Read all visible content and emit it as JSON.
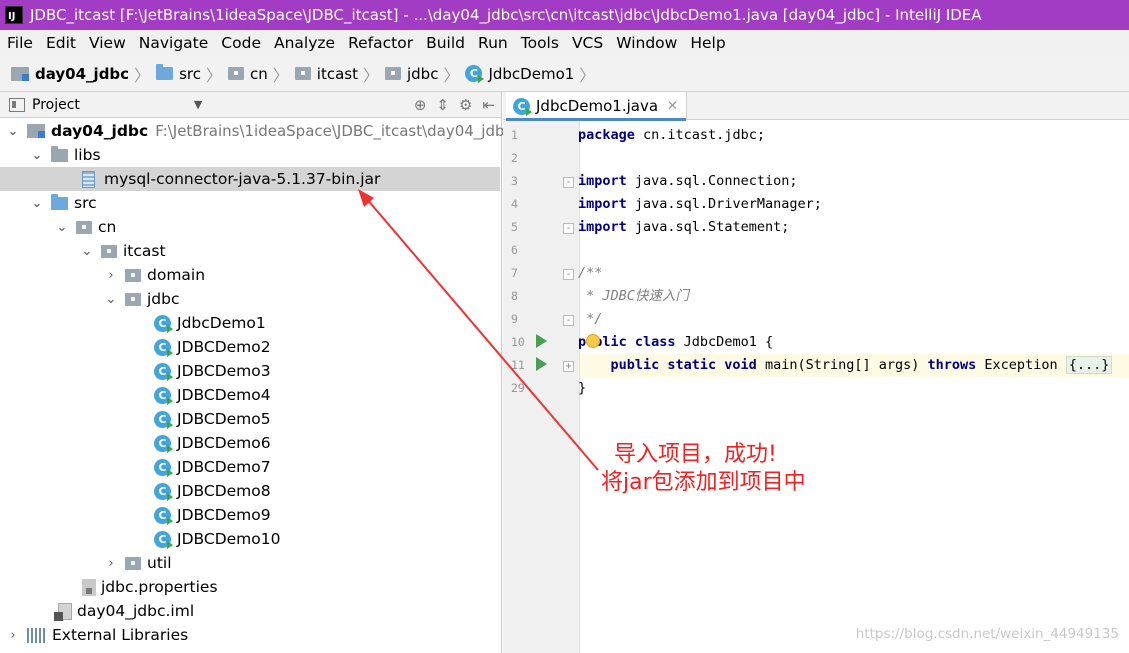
{
  "window": {
    "title": "JDBC_itcast [F:\\JetBrains\\1ideaSpace\\JDBC_itcast] - ...\\day04_jdbc\\src\\cn\\itcast\\jdbc\\JdbcDemo1.java [day04_jdbc] - IntelliJ IDEA",
    "app_icon": "intellij-icon"
  },
  "menu": [
    "File",
    "Edit",
    "View",
    "Navigate",
    "Code",
    "Analyze",
    "Refactor",
    "Build",
    "Run",
    "Tools",
    "VCS",
    "Window",
    "Help"
  ],
  "breadcrumb": [
    "day04_jdbc",
    "src",
    "cn",
    "itcast",
    "jdbc",
    "JdbcDemo1"
  ],
  "project_pane": {
    "view_label": "Project",
    "tree": {
      "root_label": "day04_jdbc",
      "root_path": "F:\\JetBrains\\1ideaSpace\\JDBC_itcast\\day04_jdbc",
      "libs_label": "libs",
      "jar_label": "mysql-connector-java-5.1.37-bin.jar",
      "src_label": "src",
      "cn_label": "cn",
      "itcast_label": "itcast",
      "domain_label": "domain",
      "jdbc_label": "jdbc",
      "classes": [
        "JdbcDemo1",
        "JDBCDemo2",
        "JDBCDemo3",
        "JDBCDemo4",
        "JDBCDemo5",
        "JDBCDemo6",
        "JDBCDemo7",
        "JDBCDemo8",
        "JDBCDemo9",
        "JDBCDemo10"
      ],
      "util_label": "util",
      "properties_label": "jdbc.properties",
      "iml_label": "day04_jdbc.iml",
      "external_label": "External Libraries"
    }
  },
  "editor": {
    "tab_label": "JdbcDemo1.java",
    "line_numbers": [
      "1",
      "2",
      "3",
      "4",
      "5",
      "6",
      "7",
      "8",
      "9",
      "10",
      "11",
      "29"
    ],
    "lines": {
      "l1_kw": "package",
      "l1_rest": " cn.itcast.jdbc;",
      "l3_kw": "import",
      "l3_rest": " java.sql.Connection;",
      "l4_kw": "import",
      "l4_rest": " java.sql.DriverManager;",
      "l5_kw": "import",
      "l5_rest": " java.sql.Statement;",
      "l7": "/**",
      "l8": " * JDBC快速入门",
      "l9": " */",
      "l10_kw": "public class",
      "l10_rest": " JdbcDemo1 {",
      "l11_indent": "    ",
      "l11_kw1": "public static void",
      "l11_mid": " main(String[] args) ",
      "l11_kw2": "throws",
      "l11_rest": " Exception ",
      "l11_fold": "{...}",
      "l29": "}"
    }
  },
  "annotation": {
    "line1": "导入项目，成功!",
    "line2": "将jar包添加到项目中",
    "color": "#ee2222"
  },
  "watermark": "https://blog.csdn.net/weixin_44949135"
}
